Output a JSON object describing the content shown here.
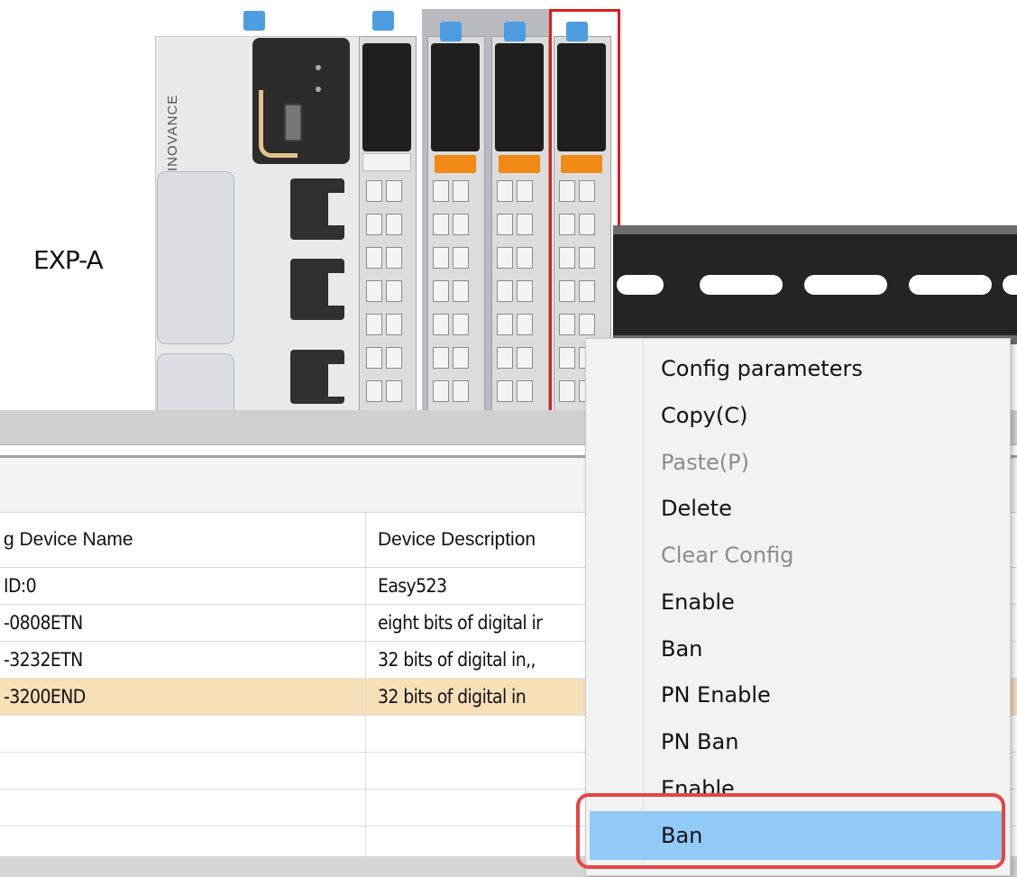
{
  "hardware": {
    "label": "EXP-A",
    "brand": "INOVANCE"
  },
  "table": {
    "columns": [
      "g Device Name",
      "Device Description"
    ],
    "rows": [
      {
        "name": "ID:0",
        "description": "Easy523"
      },
      {
        "name": "-0808ETN",
        "description": "eight bits of digital ir"
      },
      {
        "name": "-3232ETN",
        "description": "32 bits of digital in,,"
      },
      {
        "name": "-3200END",
        "description": "32 bits of digital in"
      },
      {
        "name": "",
        "description": ""
      },
      {
        "name": "",
        "description": ""
      },
      {
        "name": "",
        "description": ""
      },
      {
        "name": "",
        "description": ""
      }
    ],
    "selected_row": 3
  },
  "context_menu": {
    "items": [
      {
        "label": "Config parameters",
        "enabled": true
      },
      {
        "label": "Copy(C)",
        "enabled": true
      },
      {
        "label": "Paste(P)",
        "enabled": false
      },
      {
        "label": "Delete",
        "enabled": true
      },
      {
        "label": "Clear Config",
        "enabled": false
      },
      {
        "label": "Enable",
        "enabled": true
      },
      {
        "label": "Ban",
        "enabled": true
      },
      {
        "label": "PN Enable",
        "enabled": true
      },
      {
        "label": "PN Ban",
        "enabled": true
      },
      {
        "label": "Enable",
        "enabled": true
      },
      {
        "label": "Ban",
        "enabled": true,
        "highlighted": true
      }
    ]
  },
  "colors": {
    "selection_row": "#f7dfb8",
    "menu_highlight": "#91c9f7",
    "annotation_red": "#e64545",
    "module_selected_border": "#e01b1b"
  }
}
